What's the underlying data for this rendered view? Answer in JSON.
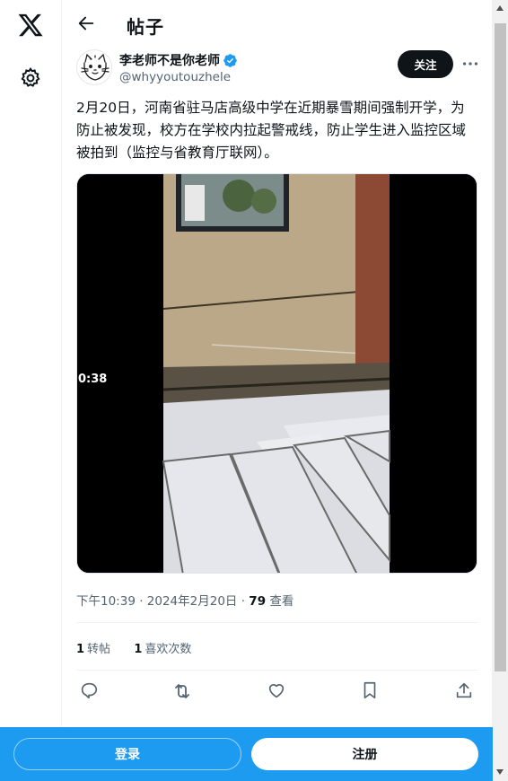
{
  "nav": {
    "logo_icon": "x-logo-icon",
    "settings_icon": "gear-icon"
  },
  "header": {
    "back_icon": "arrow-left-icon",
    "title": "帖子"
  },
  "author": {
    "name": "李老师不是你老师",
    "handle": "@whyyoutouzhele",
    "verified": true,
    "follow_label": "关注"
  },
  "tweet": {
    "text": "2月20日，河南省驻马店高级中学在近期暴雪期间强制开学，为防止被发现，校方在学校内拉起警戒线，防止学生进入监控区域被拍到（监控与省教育厅联网）。",
    "video_duration": "0:38",
    "timestamp": "下午10:39 · 2024年2月20日",
    "views_count": "79",
    "views_label": "查看"
  },
  "stats": {
    "retweets_count": "1",
    "retweets_label": "转帖",
    "likes_count": "1",
    "likes_label": "喜欢次数"
  },
  "actions": [
    "reply-icon",
    "retweet-icon",
    "like-icon",
    "bookmark-icon",
    "share-icon"
  ],
  "bottom": {
    "login_label": "登录",
    "signup_label": "注册"
  },
  "colors": {
    "accent": "#1d9bf0",
    "text": "#0f1419",
    "secondary": "#536471"
  }
}
